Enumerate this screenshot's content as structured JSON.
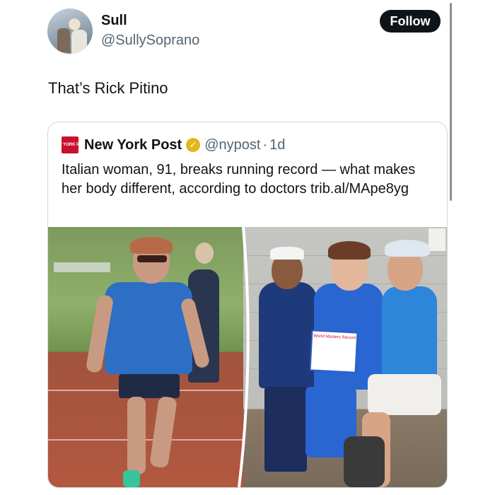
{
  "tweet": {
    "display_name": "Sull",
    "handle": "@SullySoprano",
    "follow_label": "Follow",
    "text": "That’s Rick Pitino"
  },
  "quoted_tweet": {
    "logo_text": "NEW YORK POST",
    "name": "New York Post",
    "verified_icon": "verified-badge-icon",
    "handle": "@nypost",
    "dot": "·",
    "time": "1d",
    "text": "Italian woman, 91, breaks running record — what makes her body different, according to doctors trib.al/MApe8yg",
    "sign_text": "World Masters Record"
  },
  "colors": {
    "follow_bg": "#0f1419",
    "text_primary": "#0f1419",
    "text_secondary": "#536471",
    "border": "#cfd9de",
    "nyp_red": "#c8102e",
    "verified_gold": "#e2b719"
  }
}
